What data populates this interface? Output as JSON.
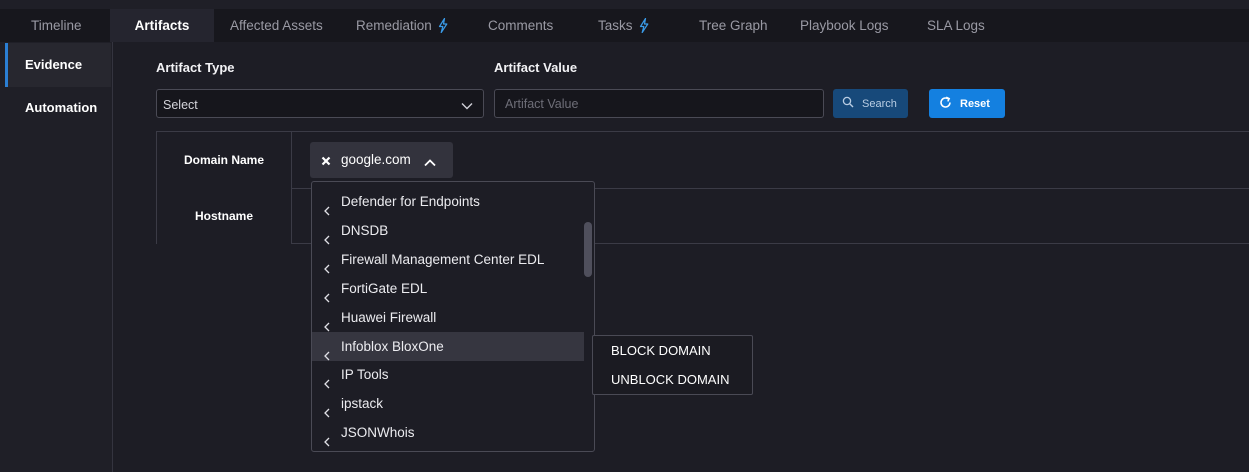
{
  "tabs": [
    {
      "label": "Timeline"
    },
    {
      "label": "Artifacts",
      "active": true
    },
    {
      "label": "Affected Assets"
    },
    {
      "label": "Remediation",
      "badge": "bolt-icon"
    },
    {
      "label": "Comments"
    },
    {
      "label": "Tasks",
      "badge": "bolt-icon"
    },
    {
      "label": "Tree Graph"
    },
    {
      "label": "Playbook Logs"
    },
    {
      "label": "SLA Logs"
    }
  ],
  "sidebar": {
    "items": [
      {
        "label": "Evidence",
        "active": true
      },
      {
        "label": "Automation"
      }
    ]
  },
  "filters": {
    "artifact_type_label": "Artifact Type",
    "artifact_type_value": "Select",
    "artifact_value_label": "Artifact Value",
    "artifact_value_placeholder": "Artifact Value",
    "search_label": "Search",
    "reset_label": "Reset"
  },
  "table": {
    "rows": [
      {
        "header": "Domain Name"
      },
      {
        "header": "Hostname"
      }
    ]
  },
  "chip": {
    "value": "google.com"
  },
  "dropdown": {
    "items": [
      "Defender for Endpoints",
      "DNSDB",
      "Firewall Management Center EDL",
      "FortiGate EDL",
      "Huawei Firewall",
      "Infoblox BloxOne",
      "IP Tools",
      "ipstack",
      "JSONWhois"
    ],
    "highlighted": "Infoblox BloxOne"
  },
  "submenu": {
    "items": [
      "BLOCK DOMAIN",
      "UNBLOCK DOMAIN"
    ]
  },
  "colors": {
    "accent": "#1480e0",
    "search_button": "#17497a",
    "bolt": "#3a9be8",
    "background": "#1d1d25"
  }
}
